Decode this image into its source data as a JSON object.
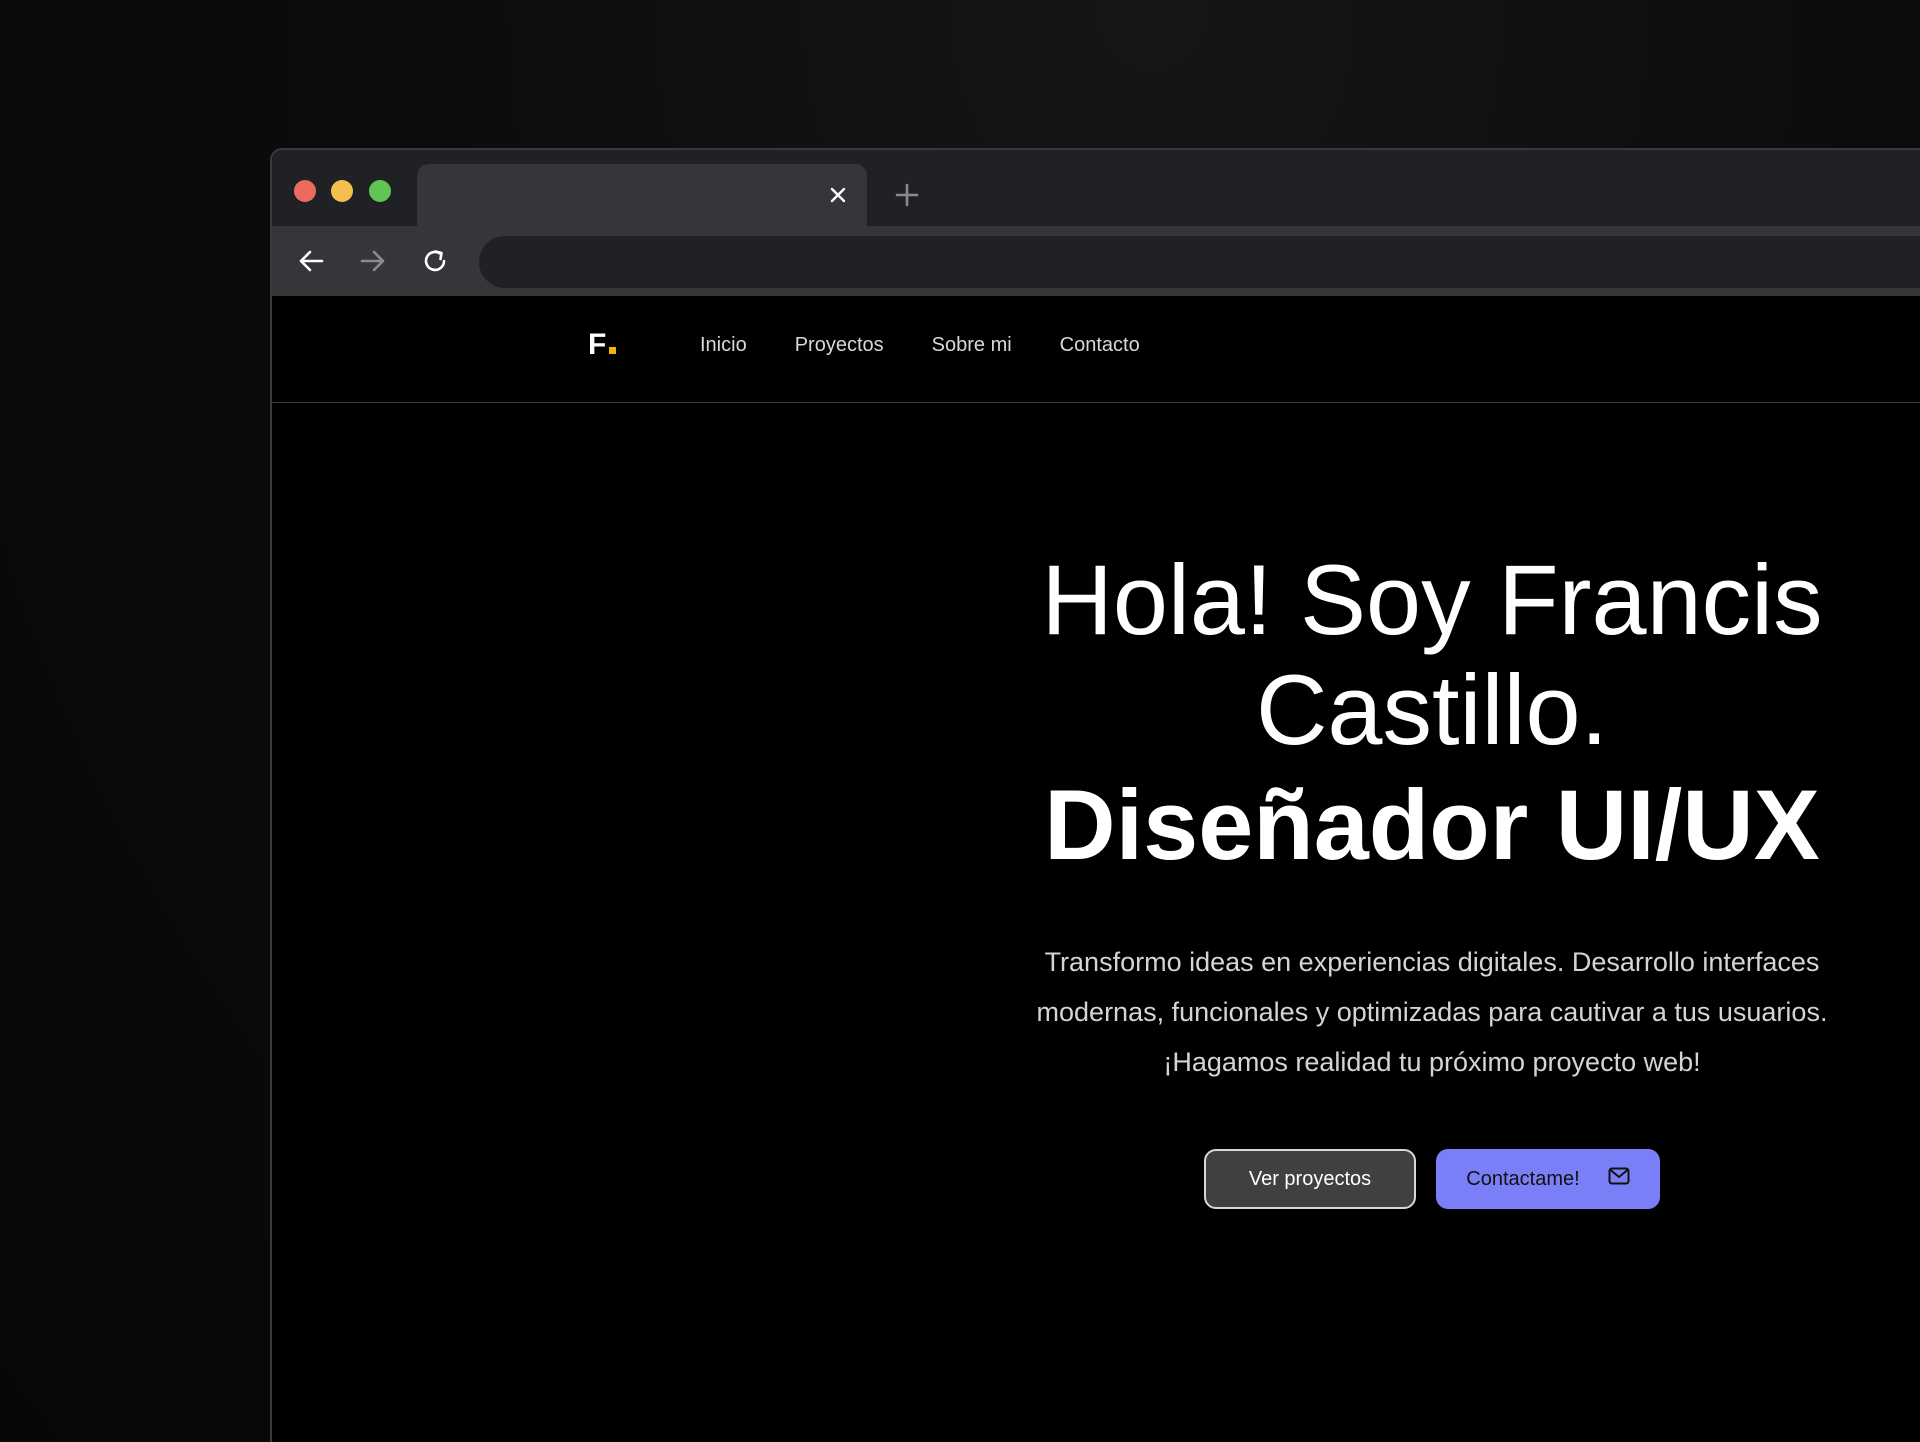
{
  "browser": {
    "tab_title": "",
    "address": ""
  },
  "site": {
    "logo_text": "F",
    "nav": [
      "Inicio",
      "Proyectos",
      "Sobre mi",
      "Contacto"
    ]
  },
  "hero": {
    "title_line1": "Hola! Soy Francis",
    "title_line2": "Castillo.",
    "role": "Diseñador UI/UX",
    "description_lines": [
      "Transformo ideas en experiencias digitales. Desarrollo interfaces",
      "modernas, funcionales y optimizadas para cautivar a tus usuarios.",
      "¡Hagamos realidad tu próximo proyecto web!"
    ],
    "primary_button": "Contactame!",
    "secondary_button": "Ver proyectos"
  },
  "colors": {
    "accent": "#7b7ff7",
    "logo_dot": "#f5b300",
    "background": "#000000"
  },
  "icons": {
    "tab_close": "close-icon",
    "new_tab": "plus-icon",
    "back": "arrow-left-icon",
    "forward": "arrow-right-icon",
    "reload": "reload-icon",
    "contact": "mail-icon"
  }
}
